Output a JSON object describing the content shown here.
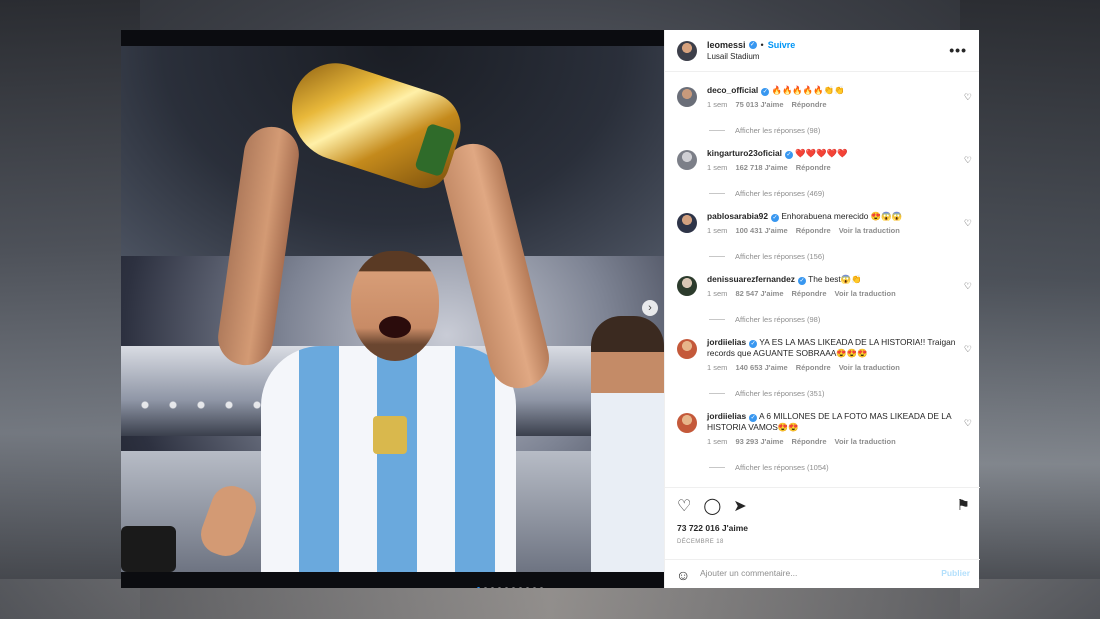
{
  "post": {
    "username": "leomessi",
    "separator": "•",
    "follow_label": "Suivre",
    "location": "Lusail Stadium",
    "more_label": "•••",
    "likes": "73 722 016 J'aime",
    "date": "DÉCEMBRE 18",
    "comment_placeholder": "Ajouter un commentaire...",
    "publish_label": "Publier"
  },
  "comments": [
    {
      "user": "deco_official",
      "text": "🔥🔥🔥🔥🔥👏👏",
      "time": "1 sem",
      "likes": "75 013 J'aime",
      "reply": "Répondre",
      "translate": "",
      "replies": "Afficher les réponses (98)"
    },
    {
      "user": "kingarturo23oficial",
      "text": "❤️❤️❤️❤️❤️",
      "time": "1 sem",
      "likes": "162 718 J'aime",
      "reply": "Répondre",
      "translate": "",
      "replies": "Afficher les réponses (469)"
    },
    {
      "user": "pablosarabia92",
      "text": "Enhorabuena merecido 😍😱😱",
      "time": "1 sem",
      "likes": "100 431 J'aime",
      "reply": "Répondre",
      "translate": "Voir la traduction",
      "replies": "Afficher les réponses (156)"
    },
    {
      "user": "denissuarezfernandez",
      "text": "The best😱👏",
      "time": "1 sem",
      "likes": "82 547 J'aime",
      "reply": "Répondre",
      "translate": "Voir la traduction",
      "replies": "Afficher les réponses (98)"
    },
    {
      "user": "jordiielias",
      "text": "YA ES LA MAS LIKEADA DE LA HISTORIA!! Traigan records que AGUANTE SOBRAAA😍😍😍",
      "time": "1 sem",
      "likes": "140 653 J'aime",
      "reply": "Répondre",
      "translate": "Voir la traduction",
      "replies": "Afficher les réponses (351)"
    },
    {
      "user": "jordiielias",
      "text": "A 6 MILLONES DE LA FOTO MAS LIKEADA DE LA HISTORIA VAMOS😍😍",
      "time": "1 sem",
      "likes": "93 293 J'aime",
      "reply": "Répondre",
      "translate": "Voir la traduction",
      "replies": "Afficher les réponses (1054)"
    }
  ],
  "icons": {
    "heart": "♡",
    "comment": "◯",
    "share": "➤",
    "bookmark": "⚑",
    "emoji": "☺",
    "next": "›"
  }
}
